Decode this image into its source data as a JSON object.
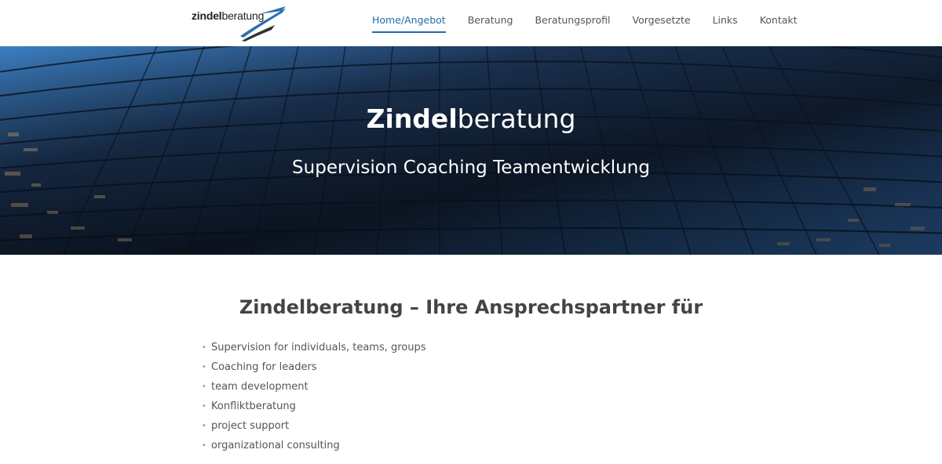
{
  "header": {
    "logo": {
      "bold": "zindel",
      "regular": "beratung"
    },
    "nav": [
      {
        "label": "Home/Angebot",
        "active": true
      },
      {
        "label": "Beratung",
        "active": false
      },
      {
        "label": "Beratungsprofil",
        "active": false
      },
      {
        "label": "Vorgesetzte",
        "active": false
      },
      {
        "label": "Links",
        "active": false
      },
      {
        "label": "Kontakt",
        "active": false
      }
    ]
  },
  "hero": {
    "title_bold": "Zindel",
    "title_regular": "beratung",
    "subtitle": "Supervision Coaching Teamentwicklung"
  },
  "main": {
    "title": "Zindelberatung – Ihre Ansprechspartner für",
    "services": [
      "Supervision for individuals, teams, groups",
      "Coaching for leaders",
      "team development",
      "Konfliktberatung",
      "project support",
      "organizational consulting"
    ]
  },
  "colors": {
    "accent": "#1f6fab",
    "text": "#444444",
    "hero_dark": "#101c2e"
  },
  "icons": {
    "logo_mark": "blue-and-black-swoosh-icon"
  }
}
